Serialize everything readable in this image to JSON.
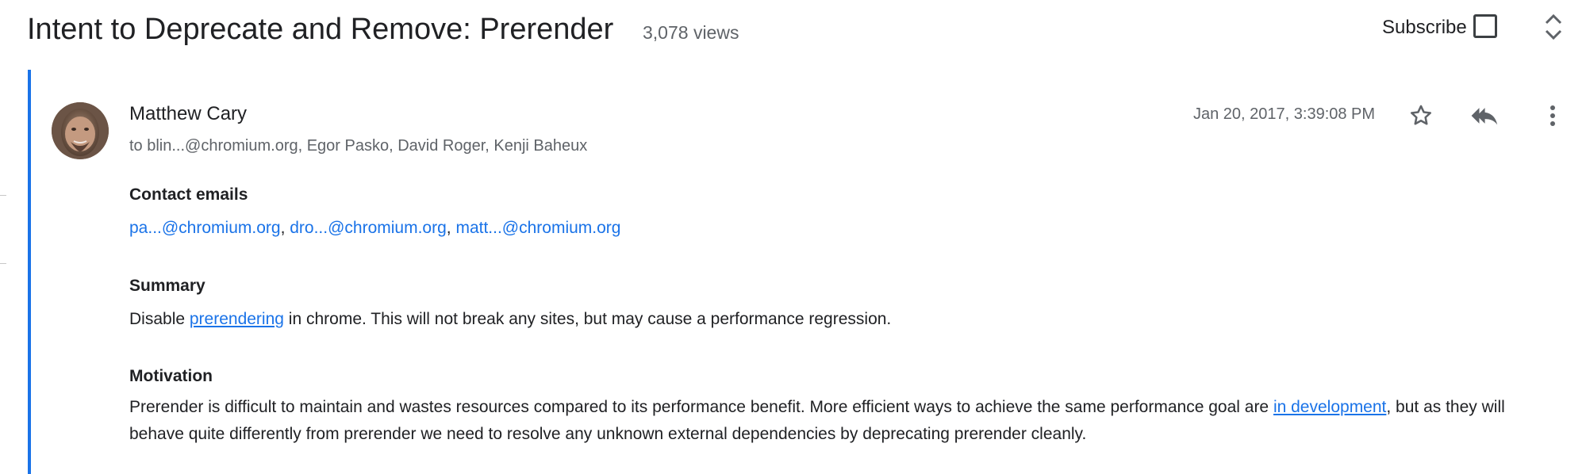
{
  "thread": {
    "title": "Intent to Deprecate and Remove: Prerender",
    "views": "3,078 views",
    "subscribe_label": "Subscribe"
  },
  "message": {
    "sender": "Matthew Cary",
    "recipients": "to blin...@chromium.org, Egor Pasko, David Roger, Kenji Baheux",
    "date": "Jan 20, 2017, 3:39:08 PM"
  },
  "contact": {
    "heading": "Contact emails",
    "emails": [
      "pa...@chromium.org",
      "dro...@chromium.org",
      "matt...@chromium.org"
    ],
    "separator": ", "
  },
  "summary": {
    "heading": "Summary",
    "before": "Disable ",
    "link": "prerendering",
    "after": " in chrome. This will not break any sites, but may cause a performance regression."
  },
  "motivation": {
    "heading": "Motivation",
    "before": "Prerender is difficult to maintain and wastes resources compared to its performance benefit. More efficient ways to achieve the same performance goal are ",
    "link": "in development",
    "after": ", but as they will behave quite differently from prerender we need to resolve any unknown external dependencies by deprecating prerender cleanly."
  },
  "icons": {
    "star": "star-icon",
    "reply_all": "reply-all-icon",
    "more": "more-vert-icon",
    "expand": "unfold-icon"
  },
  "colors": {
    "accent": "#1a73e8",
    "text": "#202124",
    "muted": "#5f6368"
  }
}
